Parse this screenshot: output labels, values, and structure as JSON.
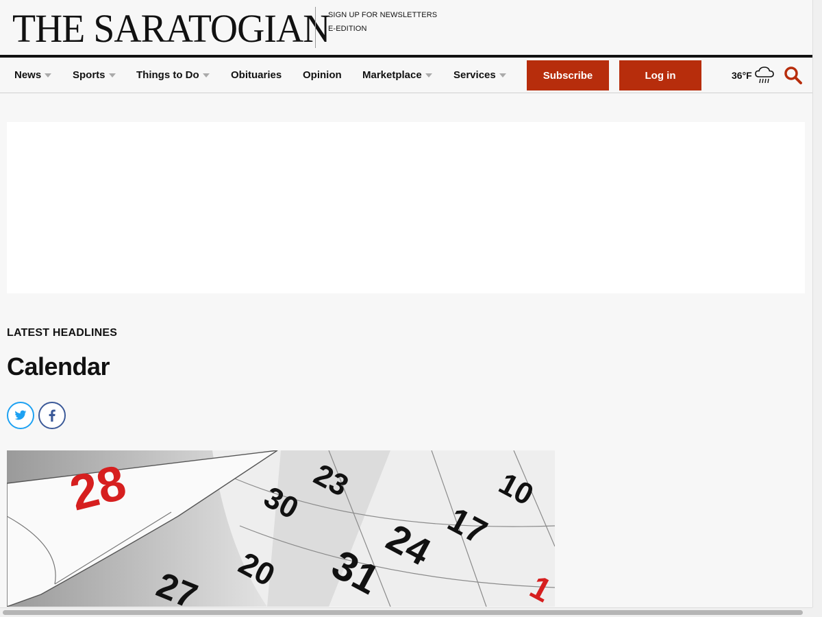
{
  "masthead": {
    "logo": "THE SARATOGIAN",
    "links": [
      "SIGN UP FOR NEWSLETTERS",
      "E-EDITION"
    ]
  },
  "nav": {
    "items": [
      {
        "label": "News",
        "dropdown": true
      },
      {
        "label": "Sports",
        "dropdown": true
      },
      {
        "label": "Things to Do",
        "dropdown": true
      },
      {
        "label": "Obituaries",
        "dropdown": false
      },
      {
        "label": "Opinion",
        "dropdown": false
      },
      {
        "label": "Marketplace",
        "dropdown": true
      },
      {
        "label": "Services",
        "dropdown": true
      }
    ],
    "subscribe_label": "Subscribe",
    "login_label": "Log in",
    "weather": {
      "temp": "36°F",
      "icon": "rain-cloud-icon"
    }
  },
  "article": {
    "kicker": "LATEST HEADLINES",
    "title": "Calendar",
    "share": [
      "twitter-icon",
      "facebook-icon"
    ],
    "image": {
      "numbers": [
        "28",
        "23",
        "10",
        "30",
        "17",
        "24",
        "31",
        "27",
        "20",
        "1"
      ]
    }
  },
  "colors": {
    "accent": "#b72d0c",
    "twitter": "#1da1f2",
    "facebook": "#3b5998",
    "calendar_red": "#d61f1f"
  }
}
